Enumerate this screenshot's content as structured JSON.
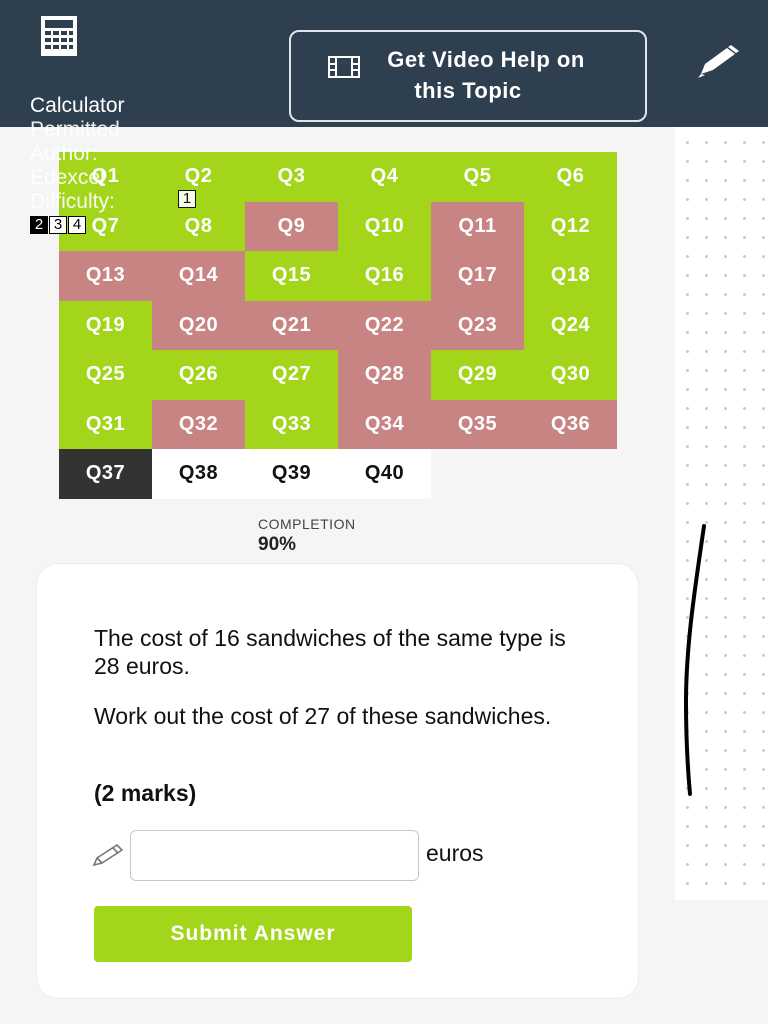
{
  "header": {
    "video_help_line1": "Get Video Help on",
    "video_help_line2": "this Topic",
    "icons": [
      "calculator-icon",
      "film-icon",
      "pen-icon"
    ]
  },
  "meta": {
    "calculator": "Calculator",
    "permitted": "Permitted",
    "author_label": "Author:",
    "author": "Edexcel",
    "difficulty_label": "Difficulty:",
    "difficulty_levels": [
      "1",
      "2",
      "3",
      "4"
    ]
  },
  "questions": [
    {
      "label": "Q1",
      "status": "green"
    },
    {
      "label": "Q2",
      "status": "green"
    },
    {
      "label": "Q3",
      "status": "green"
    },
    {
      "label": "Q4",
      "status": "green"
    },
    {
      "label": "Q5",
      "status": "green"
    },
    {
      "label": "Q6",
      "status": "green"
    },
    {
      "label": "Q7",
      "status": "green"
    },
    {
      "label": "Q8",
      "status": "green"
    },
    {
      "label": "Q9",
      "status": "red"
    },
    {
      "label": "Q10",
      "status": "green"
    },
    {
      "label": "Q11",
      "status": "red"
    },
    {
      "label": "Q12",
      "status": "green"
    },
    {
      "label": "Q13",
      "status": "red"
    },
    {
      "label": "Q14",
      "status": "red"
    },
    {
      "label": "Q15",
      "status": "green"
    },
    {
      "label": "Q16",
      "status": "green"
    },
    {
      "label": "Q17",
      "status": "red"
    },
    {
      "label": "Q18",
      "status": "green"
    },
    {
      "label": "Q19",
      "status": "green"
    },
    {
      "label": "Q20",
      "status": "red"
    },
    {
      "label": "Q21",
      "status": "red"
    },
    {
      "label": "Q22",
      "status": "red"
    },
    {
      "label": "Q23",
      "status": "red"
    },
    {
      "label": "Q24",
      "status": "green"
    },
    {
      "label": "Q25",
      "status": "green"
    },
    {
      "label": "Q26",
      "status": "green"
    },
    {
      "label": "Q27",
      "status": "green"
    },
    {
      "label": "Q28",
      "status": "red"
    },
    {
      "label": "Q29",
      "status": "green"
    },
    {
      "label": "Q30",
      "status": "green"
    },
    {
      "label": "Q31",
      "status": "green"
    },
    {
      "label": "Q32",
      "status": "red"
    },
    {
      "label": "Q33",
      "status": "green"
    },
    {
      "label": "Q34",
      "status": "red"
    },
    {
      "label": "Q35",
      "status": "red"
    },
    {
      "label": "Q36",
      "status": "red"
    },
    {
      "label": "Q37",
      "status": "current"
    },
    {
      "label": "Q38",
      "status": "pending"
    },
    {
      "label": "Q39",
      "status": "pending"
    },
    {
      "label": "Q40",
      "status": "pending"
    }
  ],
  "completion": {
    "label": "COMPLETION",
    "value": "90%"
  },
  "question": {
    "text1": "The cost of 16 sandwiches of the same type is 28 euros.",
    "text2": "Work out the cost of 27 of these sandwiches.",
    "marks": "(2 marks)",
    "answer_value": "",
    "unit": "euros",
    "submit_label": "Submit Answer"
  },
  "colors": {
    "header": "#2e3f4f",
    "correct": "#a3d61b",
    "incorrect": "#c88383",
    "current": "#333333"
  }
}
